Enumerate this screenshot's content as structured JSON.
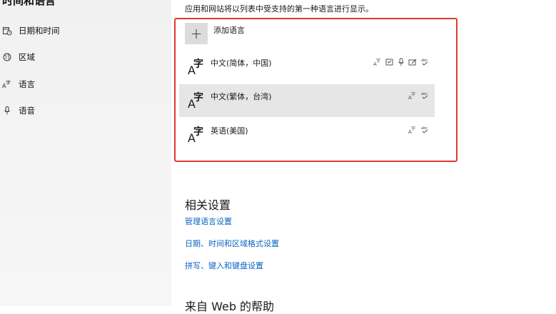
{
  "sidebar": {
    "title": "时间和语言",
    "items": [
      {
        "label": "日期和时间",
        "icon": "calendar-clock-icon"
      },
      {
        "label": "区域",
        "icon": "globe-icon"
      },
      {
        "label": "语言",
        "icon": "language-icon"
      },
      {
        "label": "语音",
        "icon": "microphone-icon"
      }
    ]
  },
  "main": {
    "intro": "应用和网站将以列表中受支持的第一种语言进行显示。",
    "add_language": "添加语言",
    "languages": [
      {
        "name": "中文(简体，中国)",
        "features": [
          "display-language-icon",
          "text-to-speech-icon",
          "speech-recognition-icon",
          "handwriting-icon",
          "spellcheck-icon"
        ],
        "selected": false
      },
      {
        "name": "中文(繁体，台湾)",
        "features": [
          "display-language-icon",
          "spellcheck-icon"
        ],
        "selected": true
      },
      {
        "name": "英语(美国)",
        "features": [
          "display-language-icon",
          "spellcheck-icon"
        ],
        "selected": false
      }
    ],
    "related_title": "相关设置",
    "links": [
      "管理语言设置",
      "日期、时间和区域格式设置",
      "拼写、键入和键盘设置"
    ],
    "help_title": "来自 Web 的帮助"
  },
  "colors": {
    "accent": "#0a65c2",
    "highlight_border": "#e0382e",
    "selected_row": "#e6e6e6"
  }
}
